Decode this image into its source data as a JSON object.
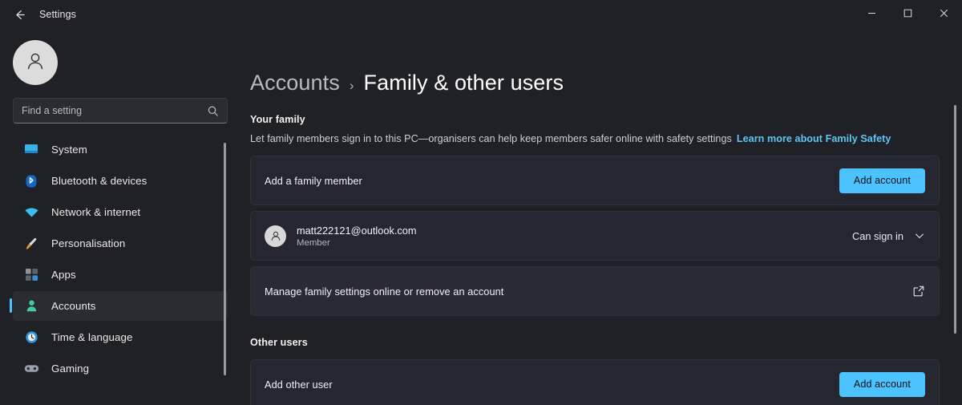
{
  "window": {
    "title": "Settings",
    "back_icon": "arrow-left-icon",
    "minimize_label": "–",
    "maximize_label": "□",
    "close_label": "✕"
  },
  "sidebar": {
    "avatar_icon": "person-avatar-icon",
    "search": {
      "value": "",
      "placeholder": "Find a setting",
      "icon": "search-icon"
    },
    "items": [
      {
        "label": "System",
        "icon": "display-monitor-icon",
        "active": false
      },
      {
        "label": "Bluetooth & devices",
        "icon": "bluetooth-icon",
        "active": false
      },
      {
        "label": "Network & internet",
        "icon": "wifi-icon",
        "active": false
      },
      {
        "label": "Personalisation",
        "icon": "paintbrush-icon",
        "active": false
      },
      {
        "label": "Apps",
        "icon": "apps-grid-icon",
        "active": false
      },
      {
        "label": "Accounts",
        "icon": "person-icon",
        "active": true
      },
      {
        "label": "Time & language",
        "icon": "clock-icon",
        "active": false
      },
      {
        "label": "Gaming",
        "icon": "gamepad-icon",
        "active": false
      }
    ]
  },
  "breadcrumb": {
    "root": "Accounts",
    "separator": "›",
    "leaf": "Family & other users"
  },
  "family": {
    "heading": "Your family",
    "description": "Let family members sign in to this PC—organisers can help keep members safer online with safety settings",
    "link": "Learn more about Family Safety",
    "add_member": {
      "label": "Add a family member",
      "button": "Add account"
    },
    "account": {
      "name": "matt222121@outlook.com",
      "role": "Member",
      "status": "Can sign in",
      "chevron_icon": "chevron-down-icon",
      "avatar_icon": "person-avatar-icon"
    },
    "manage": {
      "label": "Manage family settings online or remove an account",
      "icon": "external-link-icon"
    }
  },
  "other_users": {
    "heading": "Other users",
    "add_other": {
      "label": "Add other user",
      "button": "Add account"
    }
  },
  "colors": {
    "accent": "#4cc2ff",
    "link": "#5ec6f2",
    "window_bg": "#202027",
    "card_bg": "#262630"
  }
}
